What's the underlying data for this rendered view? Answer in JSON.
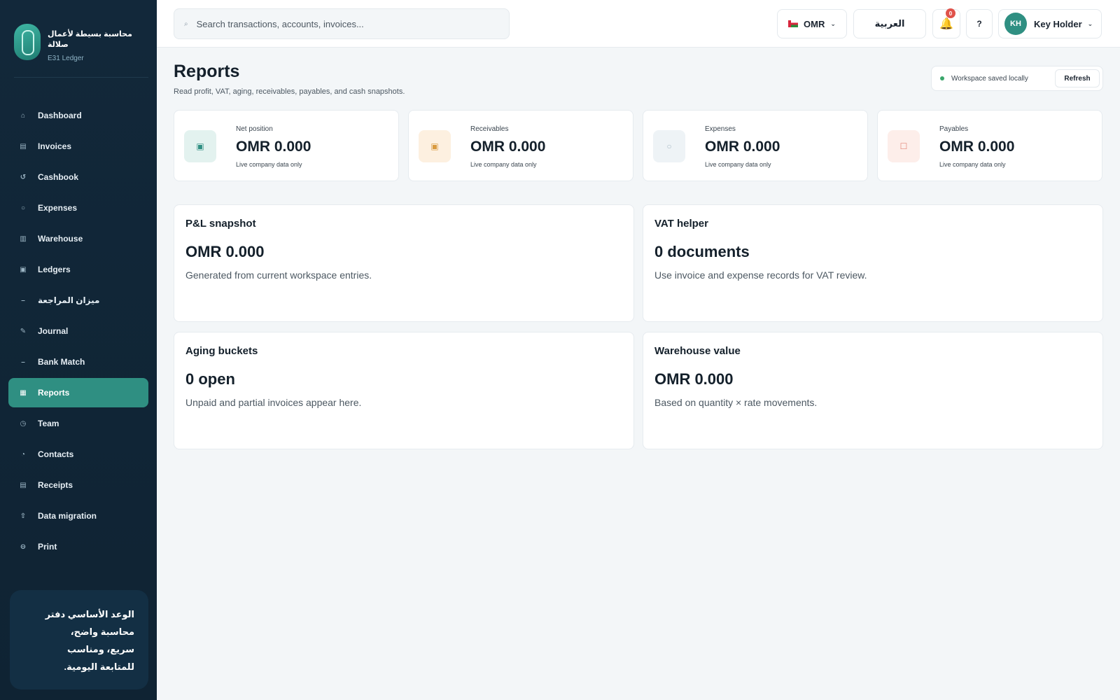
{
  "brand": {
    "name": "محاسبة بسيطة لأعمال صلالة",
    "sub": "E31 Ledger"
  },
  "sidebar": {
    "items": [
      {
        "label": "Dashboard",
        "icon": "home-icon",
        "glyph": "⌂"
      },
      {
        "label": "Invoices",
        "icon": "invoice-icon",
        "glyph": "▤"
      },
      {
        "label": "Cashbook",
        "icon": "cashbook-icon",
        "glyph": "↺"
      },
      {
        "label": "Expenses",
        "icon": "expenses-icon",
        "glyph": "○"
      },
      {
        "label": "Warehouse",
        "icon": "warehouse-icon",
        "glyph": "▥"
      },
      {
        "label": "Ledgers",
        "icon": "ledger-icon",
        "glyph": "▣"
      },
      {
        "label": "ميزان المراجعة",
        "icon": "balance-icon",
        "glyph": "–"
      },
      {
        "label": "Journal",
        "icon": "journal-icon",
        "glyph": "✎"
      },
      {
        "label": "Bank Match",
        "icon": "bank-icon",
        "glyph": "–"
      },
      {
        "label": "Reports",
        "icon": "reports-icon",
        "glyph": "▦",
        "active": true
      },
      {
        "label": "Team",
        "icon": "team-icon",
        "glyph": "◷"
      },
      {
        "label": "Contacts",
        "icon": "contacts-icon",
        "glyph": "◔"
      },
      {
        "label": "Receipts",
        "icon": "receipts-icon",
        "glyph": "▤"
      },
      {
        "label": "Data migration",
        "icon": "upload-icon",
        "glyph": "⇧"
      },
      {
        "label": "Print",
        "icon": "print-icon",
        "glyph": "⊖"
      }
    ],
    "promise": "الوعد الأساسي دفتر محاسبة واضح، سريع، ومناسب للمتابعة اليومية."
  },
  "topbar": {
    "search_placeholder": "Search transactions, accounts, invoices...",
    "currency": "OMR",
    "language": "العربية",
    "notification_count": "0",
    "help": "?",
    "user_initials": "KH",
    "user_name": "Key Holder"
  },
  "page": {
    "title": "Reports",
    "subtitle": "Read profit, VAT, aging, receivables, payables, and cash snapshots.",
    "status": "Workspace saved locally",
    "refresh": "Refresh"
  },
  "stats": [
    {
      "label": "Net position",
      "value": "OMR 0.000",
      "note": "Live company data only",
      "icon": "net-position-icon",
      "glyph": "▣",
      "bg": "#e3f2ef",
      "fg": "#2f8f82"
    },
    {
      "label": "Receivables",
      "value": "OMR 0.000",
      "note": "Live company data only",
      "icon": "receivables-icon",
      "glyph": "▣",
      "bg": "#fdf0e0",
      "fg": "#d99a3e"
    },
    {
      "label": "Expenses",
      "value": "OMR 0.000",
      "note": "Live company data only",
      "icon": "expenses-stat-icon",
      "glyph": "○",
      "bg": "#eef3f6",
      "fg": "#a9bac6"
    },
    {
      "label": "Payables",
      "value": "OMR 0.000",
      "note": "Live company data only",
      "icon": "payables-icon",
      "glyph": "☐",
      "bg": "#fdeeea",
      "fg": "#e2877a"
    }
  ],
  "cards": [
    {
      "title": "P&L snapshot",
      "value": "OMR 0.000",
      "desc": "Generated from current workspace entries."
    },
    {
      "title": "VAT helper",
      "value": "0 documents",
      "desc": "Use invoice and expense records for VAT review."
    },
    {
      "title": "Aging buckets",
      "value": "0 open",
      "desc": "Unpaid and partial invoices appear here."
    },
    {
      "title": "Warehouse value",
      "value": "OMR 0.000",
      "desc": "Based on quantity × rate movements."
    }
  ]
}
